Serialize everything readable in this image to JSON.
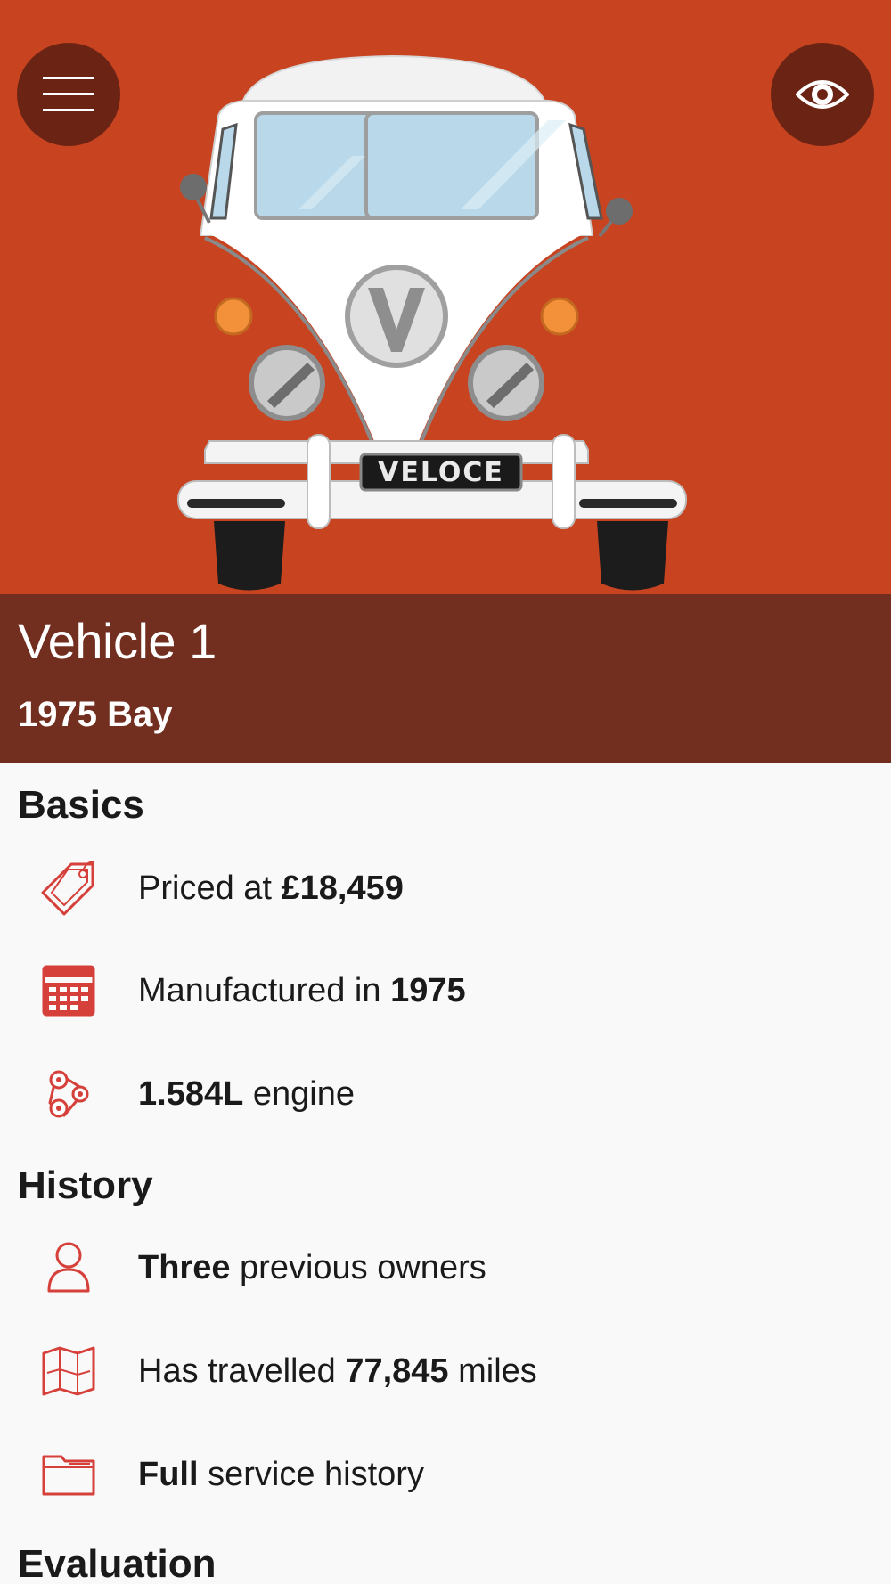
{
  "header": {
    "menu_icon": "hamburger-menu-icon",
    "view_icon": "eye-icon",
    "hero_bg": "#c84421",
    "plate": "VELOCE"
  },
  "vehicle": {
    "title": "Vehicle 1",
    "subtitle": "1975 Bay"
  },
  "sections": {
    "basics": {
      "heading": "Basics",
      "price": {
        "icon": "price-tag-icon",
        "pre": "Priced at ",
        "value": "£18,459",
        "post": ""
      },
      "year": {
        "icon": "calendar-icon",
        "pre": "Manufactured in ",
        "value": "1975",
        "post": ""
      },
      "engine": {
        "icon": "engine-belt-icon",
        "pre": "",
        "value": "1.584L",
        "post": " engine"
      }
    },
    "history": {
      "heading": "History",
      "owners": {
        "icon": "person-icon",
        "pre": "",
        "value": "Three",
        "post": " previous owners"
      },
      "mileage": {
        "icon": "map-icon",
        "pre": "Has travelled ",
        "value": "77,845",
        "post": " miles"
      },
      "service": {
        "icon": "folder-icon",
        "pre": "",
        "value": "Full",
        "post": " service history"
      }
    },
    "evaluation": {
      "heading": "Evaluation"
    }
  },
  "colors": {
    "accent": "#c84421",
    "dark_accent": "#722e1f",
    "button_bg": "#6b2414",
    "icon_red": "#d6403a"
  }
}
